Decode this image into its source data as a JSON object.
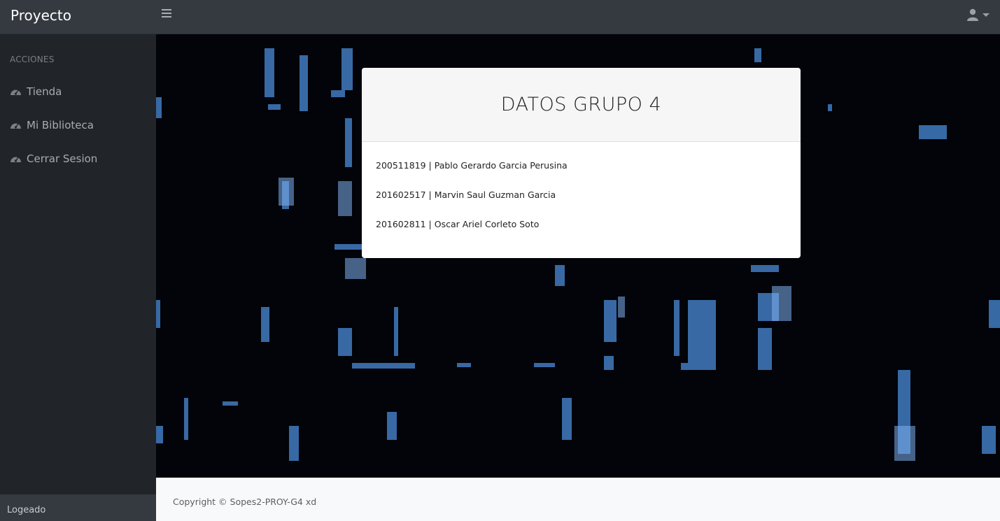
{
  "header": {
    "brand": "Proyecto",
    "menu_icon": "hamburger-icon",
    "user_icon": "user-icon"
  },
  "sidebar": {
    "heading": "ACCIONES",
    "items": [
      {
        "label": "Tienda",
        "icon": "dashboard-icon"
      },
      {
        "label": "Mi Biblioteca",
        "icon": "dashboard-icon"
      },
      {
        "label": "Cerrar Sesion",
        "icon": "dashboard-icon"
      }
    ],
    "footer": "Logeado"
  },
  "card": {
    "title": "DATOS GRUPO 4",
    "members": [
      "200511819 | Pablo Gerardo Garcia Perusina",
      "201602517 | Marvin Saul Guzman Garcia",
      "201602811 | Oscar Ariel Corleto Soto"
    ]
  },
  "footer": {
    "copyright": "Copyright © Sopes2-PROY-G4 xd"
  },
  "colors": {
    "topbar": "#343a40",
    "sidebar": "#212529",
    "background": "#020409",
    "matrix_glyph": "#4a8bd8"
  }
}
